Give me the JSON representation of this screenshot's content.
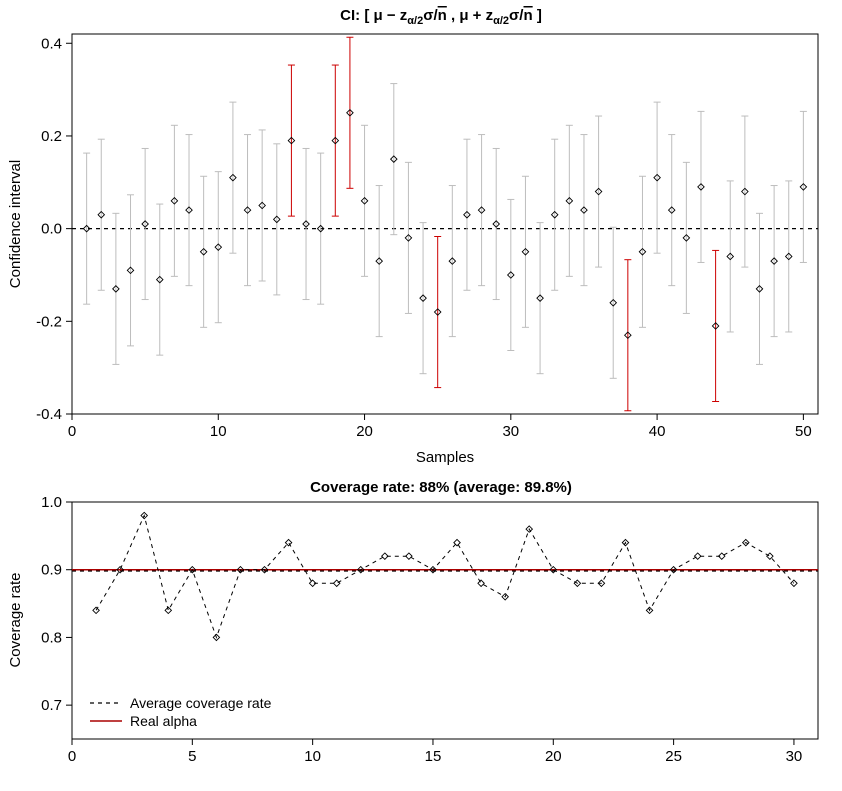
{
  "chart_data": [
    {
      "type": "scatter",
      "id": "ci_plot",
      "title": "CI: [ μ − z_{α/2} σ / √n  ,  μ + z_{α/2} σ / √n ]",
      "xlabel": "Samples",
      "ylabel": "Confidence interval",
      "xlim": [
        0,
        51
      ],
      "ylim": [
        -0.4,
        0.42
      ],
      "xticks": [
        0,
        10,
        20,
        30,
        40,
        50
      ],
      "yticks": [
        -0.4,
        -0.2,
        0.0,
        0.2,
        0.4
      ],
      "hline": 0,
      "half_width": 0.163,
      "series": [
        {
          "name": "mean",
          "values": [
            0.0,
            0.03,
            -0.13,
            -0.09,
            0.01,
            -0.11,
            0.06,
            0.04,
            -0.05,
            -0.04,
            0.11,
            0.04,
            0.05,
            0.02,
            0.19,
            0.01,
            0.0,
            0.19,
            0.25,
            0.06,
            -0.07,
            0.15,
            -0.02,
            -0.15,
            -0.18,
            -0.07,
            0.03,
            0.04,
            0.01,
            -0.1,
            -0.05,
            -0.15,
            0.03,
            0.06,
            0.04,
            0.08,
            -0.16,
            -0.23,
            -0.05,
            0.11,
            0.04,
            -0.02,
            0.09,
            -0.21,
            -0.06,
            0.08,
            -0.13,
            -0.07,
            -0.06,
            0.09
          ]
        },
        {
          "name": "miss",
          "values": [
            15,
            18,
            19,
            25,
            38,
            44
          ]
        }
      ]
    },
    {
      "type": "line",
      "id": "coverage_plot",
      "title": "Coverage rate: 88% (average: 89.8%)",
      "xlabel": "",
      "ylabel": "Coverage rate",
      "xlim": [
        0,
        31
      ],
      "ylim": [
        0.65,
        1.0
      ],
      "xticks": [
        0,
        5,
        10,
        15,
        20,
        25,
        30
      ],
      "yticks": [
        0.7,
        0.8,
        0.9,
        1.0
      ],
      "hline_real_alpha": 0.9,
      "legend": [
        "Average coverage rate",
        "Real alpha"
      ],
      "avg": 0.898,
      "series": [
        {
          "name": "coverage",
          "values": [
            0.84,
            0.9,
            0.98,
            0.84,
            0.9,
            0.8,
            0.9,
            0.9,
            0.94,
            0.88,
            0.88,
            0.9,
            0.92,
            0.92,
            0.9,
            0.94,
            0.88,
            0.86,
            0.96,
            0.9,
            0.88,
            0.88,
            0.94,
            0.84,
            0.9,
            0.92,
            0.92,
            0.94,
            0.92,
            0.88
          ]
        }
      ]
    }
  ],
  "labels": {
    "top_title_prefix": "CI: [ ",
    "top_title_mid": "μ − z",
    "top_title_alpha2a": "α/2",
    "top_title_sigmaA": "σ/",
    "top_title_rootnA": "n",
    "top_title_sep": "  ,  ",
    "top_title_mid2": "μ + z",
    "top_title_alpha2b": "α/2",
    "top_title_sigmaB": "σ/",
    "top_title_rootnB": "n",
    "top_title_suffix": " ]",
    "xlabel_top": "Samples",
    "ylabel_top": "Confidence interval",
    "title_bottom": "Coverage rate: 88% (average: 89.8%)",
    "ylabel_bottom": "Coverage rate",
    "legend1": "Average coverage rate",
    "legend2": "Real alpha"
  }
}
